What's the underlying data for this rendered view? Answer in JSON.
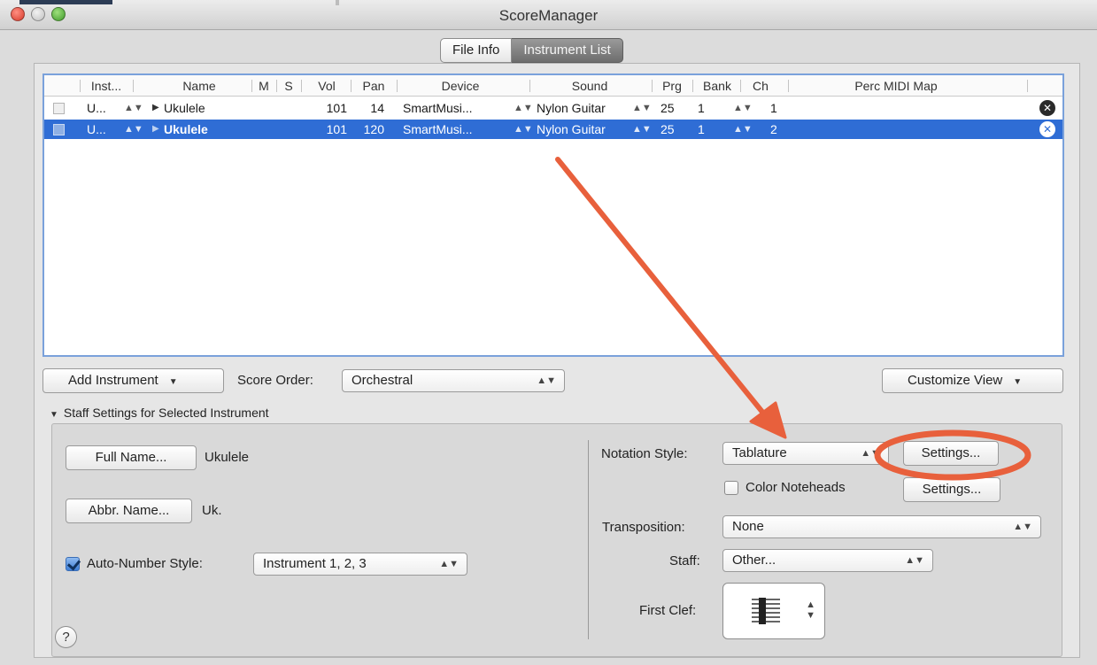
{
  "window": {
    "title": "ScoreManager"
  },
  "tabs": [
    {
      "label": "File Info",
      "active": false
    },
    {
      "label": "Instrument List",
      "active": true
    }
  ],
  "table": {
    "columns": [
      "Inst...",
      "Name",
      "M",
      "S",
      "Vol",
      "Pan",
      "Device",
      "Sound",
      "Prg",
      "Bank",
      "Ch",
      "Perc MIDI Map"
    ],
    "rows": [
      {
        "inst": "U...",
        "name": "Ukulele",
        "vol": "101",
        "pan": "14",
        "device": "SmartMusi...",
        "sound": "Nylon Guitar",
        "prg": "25",
        "bank": "1",
        "ch": "1",
        "selected": false
      },
      {
        "inst": "U...",
        "name": "Ukulele",
        "vol": "101",
        "pan": "120",
        "device": "SmartMusi...",
        "sound": "Nylon Guitar",
        "prg": "25",
        "bank": "1",
        "ch": "2",
        "selected": true
      }
    ],
    "selection_color": "#2f6dd5"
  },
  "toolbar": {
    "add_instrument": "Add Instrument",
    "score_order_label": "Score Order:",
    "score_order_value": "Orchestral",
    "customize_view": "Customize View"
  },
  "staff_settings": {
    "section_title": "Staff Settings for Selected Instrument",
    "full_name_button": "Full Name...",
    "full_name_value": "Ukulele",
    "abbr_name_button": "Abbr. Name...",
    "abbr_name_value": "Uk.",
    "auto_number_label": "Auto-Number Style:",
    "auto_number_checked": true,
    "auto_number_value": "Instrument 1, 2, 3",
    "notation_style_label": "Notation Style:",
    "notation_style_value": "Tablature",
    "notation_settings_button": "Settings...",
    "color_noteheads_label": "Color Noteheads",
    "color_noteheads_checked": false,
    "color_settings_button": "Settings...",
    "transposition_label": "Transposition:",
    "transposition_value": "None",
    "staff_label": "Staff:",
    "staff_value": "Other...",
    "first_clef_label": "First Clef:",
    "help_label": "?"
  },
  "annotation": {
    "color": "#e8603c"
  }
}
